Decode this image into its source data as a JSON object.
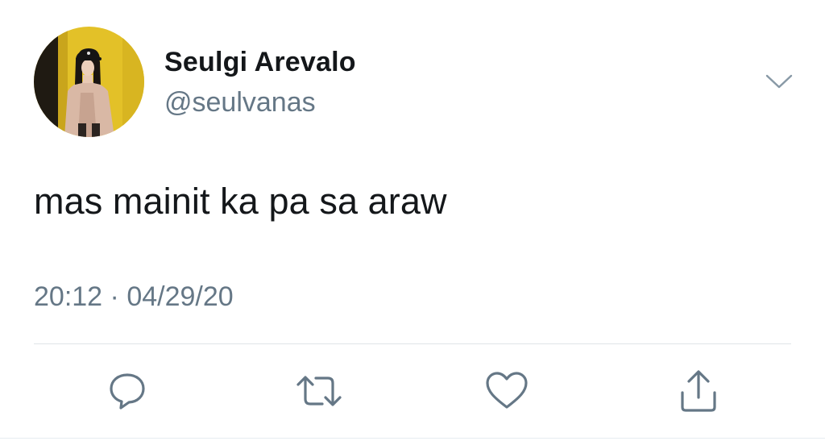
{
  "tweet": {
    "display_name": "Seulgi Arevalo",
    "handle": "@seulvanas",
    "text": "mas mainit ka pa sa araw",
    "time": "20:12",
    "separator": "·",
    "date": "04/29/20"
  },
  "icons": {
    "menu": "chevron-down-icon",
    "reply": "reply-icon",
    "retweet": "retweet-icon",
    "like": "heart-icon",
    "share": "share-icon"
  },
  "colors": {
    "primary_text": "#14171a",
    "secondary_text": "#657786",
    "icon": "#657786",
    "divider": "#dfe4e8",
    "avatar_bg": "#e8c42a"
  }
}
